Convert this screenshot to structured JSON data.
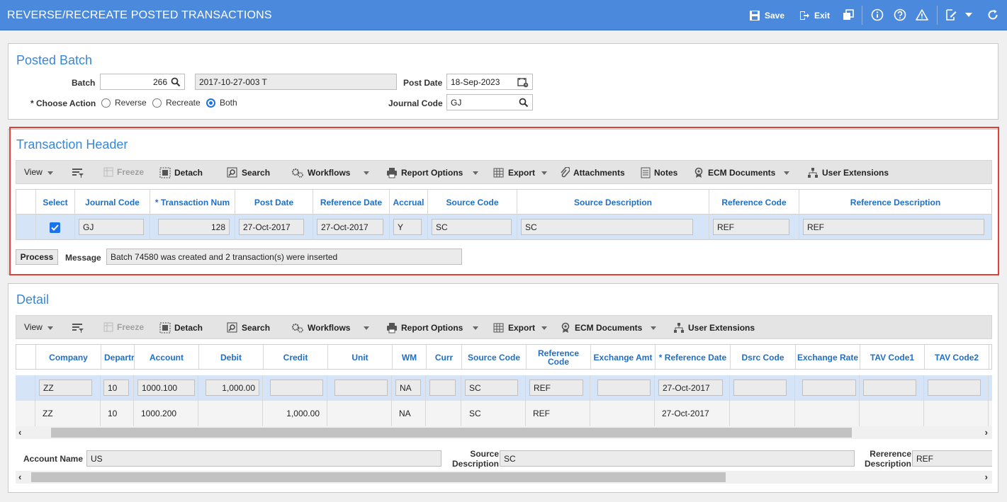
{
  "app": {
    "title": "REVERSE/RECREATE POSTED TRANSACTIONS",
    "save_label": "Save",
    "exit_label": "Exit"
  },
  "posted_batch": {
    "title": "Posted Batch",
    "batch_label": "Batch",
    "batch_value": "266",
    "batch_desc": "2017-10-27-003 T",
    "post_date_label": "Post Date",
    "post_date_value": "18-Sep-2023",
    "choose_action_label": "* Choose Action",
    "actions": [
      {
        "label": "Reverse",
        "selected": false
      },
      {
        "label": "Recreate",
        "selected": false
      },
      {
        "label": "Both",
        "selected": true
      }
    ],
    "journal_code_label": "Journal Code",
    "journal_code_value": "GJ"
  },
  "transaction_header": {
    "title": "Transaction Header",
    "toolbar": {
      "view": "View",
      "freeze": "Freeze",
      "detach": "Detach",
      "search": "Search",
      "workflows": "Workflows",
      "report_options": "Report Options",
      "export": "Export",
      "attachments": "Attachments",
      "notes": "Notes",
      "ecm_documents": "ECM Documents",
      "user_extensions": "User Extensions"
    },
    "columns": [
      "Select",
      "Journal Code",
      "* Transaction Num",
      "Post Date",
      "Reference Date",
      "Accrual",
      "Source Code",
      "Source Description",
      "Reference Code",
      "Reference Description"
    ],
    "row": {
      "selected": true,
      "journal_code": "GJ",
      "transaction_num": "128",
      "post_date": "27-Oct-2017",
      "reference_date": "27-Oct-2017",
      "accrual": "Y",
      "source_code": "SC",
      "source_description": "SC",
      "reference_code": "REF",
      "reference_description": "REF"
    },
    "process_label": "Process",
    "message_label": "Message",
    "message_value": "Batch 74580 was created and 2 transaction(s) were inserted"
  },
  "detail": {
    "title": "Detail",
    "toolbar": {
      "view": "View",
      "freeze": "Freeze",
      "detach": "Detach",
      "search": "Search",
      "workflows": "Workflows",
      "report_options": "Report Options",
      "export": "Export",
      "ecm_documents": "ECM Documents",
      "user_extensions": "User Extensions"
    },
    "columns": [
      "Company",
      "Departr",
      "Account",
      "Debit",
      "Credit",
      "Unit",
      "WM",
      "Curr",
      "Source Code",
      "Reference Code",
      "Exchange Amt",
      "* Reference Date",
      "Dsrc Code",
      "Exchange Rate",
      "TAV Code1",
      "TAV Code2"
    ],
    "rows": [
      {
        "company": "ZZ",
        "dept": "10",
        "account": "1000.100",
        "debit": "1,000.00",
        "credit": "",
        "unit": "",
        "wm": "NA",
        "curr": "",
        "source_code": "SC",
        "reference_code": "REF",
        "exchange_amt": "",
        "reference_date": "27-Oct-2017",
        "dsrc_code": "",
        "exchange_rate": "",
        "tav1": "",
        "tav2": ""
      },
      {
        "company": "ZZ",
        "dept": "10",
        "account": "1000.200",
        "debit": "",
        "credit": "1,000.00",
        "unit": "",
        "wm": "NA",
        "curr": "",
        "source_code": "SC",
        "reference_code": "REF",
        "exchange_amt": "",
        "reference_date": "27-Oct-2017",
        "dsrc_code": "",
        "exchange_rate": "",
        "tav1": "",
        "tav2": ""
      }
    ],
    "account_name_label": "Account Name",
    "account_name_value": "US",
    "source_description_label": "Source Description",
    "source_description_value": "SC",
    "reference_description_label": "Rererence Description",
    "reference_description_value": "REF"
  },
  "colors": {
    "titlebar": "#4a89dc",
    "accent": "#3a87d6",
    "highlight_border": "#e0403a",
    "selected_row": "#d5e4f7"
  }
}
